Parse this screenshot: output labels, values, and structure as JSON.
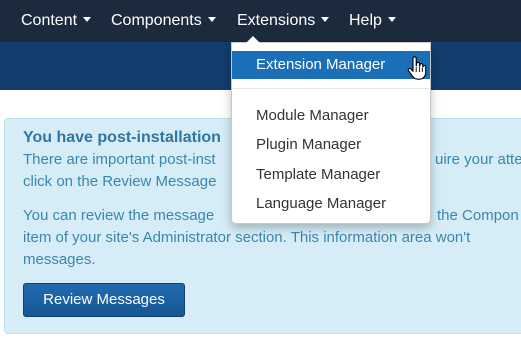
{
  "nav": {
    "items": [
      {
        "label": "Content"
      },
      {
        "label": "Components"
      },
      {
        "label": "Extensions"
      },
      {
        "label": "Help"
      }
    ]
  },
  "dropdown": {
    "active_item": "Extension Manager",
    "items": [
      {
        "label": "Module Manager"
      },
      {
        "label": "Plugin Manager"
      },
      {
        "label": "Template Manager"
      },
      {
        "label": "Language Manager"
      }
    ]
  },
  "alert": {
    "heading": "You have post-installation",
    "line1": "There are important post-inst",
    "line1_tail": "uire your atte",
    "line2": "click on the Review Message",
    "line3": "You can review the message",
    "line3_tail": "the Compon",
    "line4": "item of your site's Administrator section. This information area won't",
    "line5": "messages.",
    "button_label": "Review Messages"
  },
  "colors": {
    "nav_bg": "#1c2a3d",
    "header_bg": "#123d6d",
    "alert_bg": "#d6edf7",
    "alert_text": "#3a87ad",
    "active_item_bg": "#1b6fb7",
    "button_bg": "#1f6bb0"
  },
  "icons": {
    "cursor": "hand-pointer-icon",
    "caret": "caret-down-icon"
  }
}
